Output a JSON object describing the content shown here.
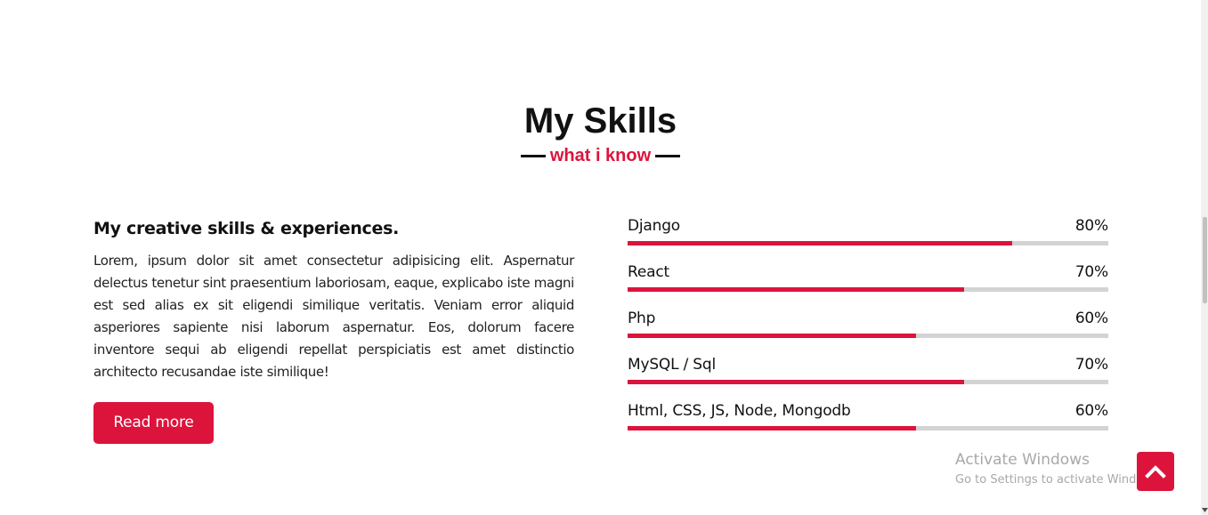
{
  "section": {
    "title": "My Skills",
    "subtitle": "what i know"
  },
  "about": {
    "heading": "My creative skills & experiences.",
    "text": "Lorem, ipsum dolor sit amet consectetur adipisicing elit. Aspernatur delectus tenetur sint praesentium laboriosam, eaque, explicabo iste magni est sed alias ex sit eligendi similique veritatis. Veniam error aliquid asperiores sapiente nisi laborum aspernatur. Eos, dolorum facere inventore sequi ab eligendi repellat perspiciatis est amet distinctio architecto recusandae iste similique!",
    "button_label": "Read more"
  },
  "skills": [
    {
      "name": "Django",
      "percent_label": "80%",
      "level": 0.8
    },
    {
      "name": "React",
      "percent_label": "70%",
      "level": 0.7
    },
    {
      "name": "Php",
      "percent_label": "60%",
      "level": 0.6
    },
    {
      "name": "MySQL / Sql",
      "percent_label": "70%",
      "level": 0.7
    },
    {
      "name": "Html, CSS, JS, Node, Mongodb",
      "percent_label": "60%",
      "level": 0.6
    }
  ],
  "watermark": {
    "title": "Activate Windows",
    "subtitle": "Go to Settings to activate Windows."
  },
  "icons": {
    "scroll_top": "chevron-up-icon",
    "scrollbar_down": "caret-down-icon"
  },
  "colors": {
    "accent": "#dc143c",
    "track": "#d3d3d3",
    "text": "#111111"
  }
}
